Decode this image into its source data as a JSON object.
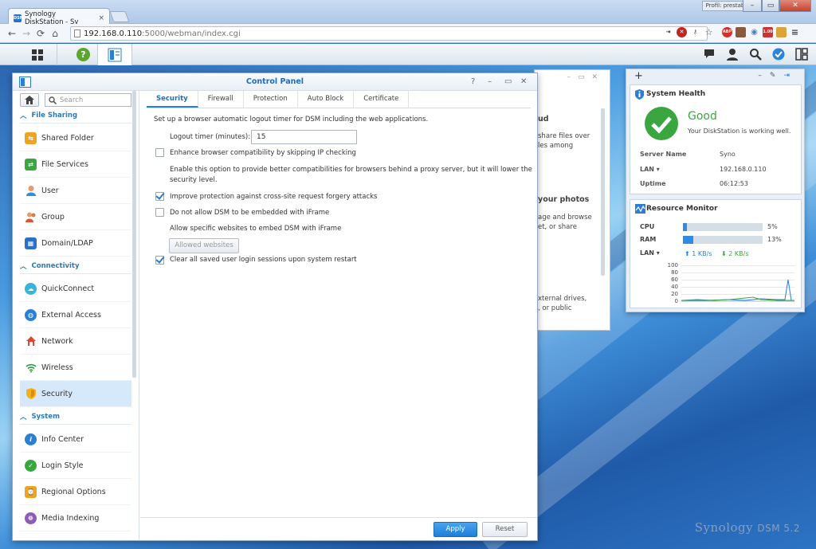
{
  "browser": {
    "tab_title": "Synology DiskStation - Sy",
    "tab_favicon": "DSM",
    "profile_label": "Profil: prestab...",
    "url_host": "192.168.0.110",
    "url_rest": ":5000/webman/index.cgi",
    "ext_badge": "1.00",
    "ext_abp": "ABP"
  },
  "control_panel": {
    "title": "Control Panel",
    "search_placeholder": "Search",
    "sections": [
      {
        "label": "File Sharing"
      },
      {
        "label": "Connectivity"
      },
      {
        "label": "System"
      }
    ],
    "items": [
      {
        "label": "Shared Folder"
      },
      {
        "label": "File Services"
      },
      {
        "label": "User"
      },
      {
        "label": "Group"
      },
      {
        "label": "Domain/LDAP"
      },
      {
        "label": "QuickConnect"
      },
      {
        "label": "External Access"
      },
      {
        "label": "Network"
      },
      {
        "label": "Wireless"
      },
      {
        "label": "Security"
      },
      {
        "label": "Info Center"
      },
      {
        "label": "Login Style"
      },
      {
        "label": "Regional Options"
      },
      {
        "label": "Media Indexing"
      }
    ],
    "tabs": [
      "Security",
      "Firewall",
      "Protection",
      "Auto Block",
      "Certificate"
    ],
    "content": {
      "intro": "Set up a browser automatic logout timer for DSM including the web applications.",
      "logout_label": "Logout timer (minutes):",
      "logout_value": "15",
      "opt_ip_check": "Enhance browser compatibility by skipping IP checking",
      "desc_ip_1": "Enable this option to provide better compatibilities for browsers behind a proxy server, but it will lower the",
      "desc_ip_2": "security level.",
      "opt_csrf": "Improve protection against cross-site request forgery attacks",
      "opt_iframe": "Do not allow DSM to be embedded with iFrame",
      "desc_iframe": "Allow specific websites to embed DSM with iFrame",
      "allowed_btn": "Allowed websites",
      "opt_clear": "Clear all saved user login sessions upon system restart"
    },
    "apply": "Apply",
    "reset": "Reset"
  },
  "behind_window": {
    "lines": [
      "ud",
      "share files over",
      "les among",
      "your photos",
      "age and browse",
      "et, or share",
      "xternal drives,",
      ", or public"
    ]
  },
  "widgets": {
    "health": {
      "title": "System Health",
      "status": "Good",
      "message": "Your DiskStation is working well.",
      "server_name_label": "Server Name",
      "server_name": "Syno",
      "lan_label": "LAN",
      "lan_value": "192.168.0.110",
      "uptime_label": "Uptime",
      "uptime": "06:12:53"
    },
    "resource": {
      "title": "Resource Monitor",
      "cpu_label": "CPU",
      "cpu_pct": 5,
      "cpu_text": "5%",
      "ram_label": "RAM",
      "ram_pct": 13,
      "ram_text": "13%",
      "lan_label": "LAN",
      "up": "1 KB/s",
      "down": "2 KB/s",
      "yticks": [
        "100",
        "80",
        "60",
        "40",
        "20",
        "0"
      ]
    }
  },
  "brand": {
    "name": "Synology",
    "version": "DSM 5.2"
  },
  "colors": {
    "accent": "#1e6bbd",
    "good": "#3aa640",
    "selected": "#d6e9fa"
  }
}
